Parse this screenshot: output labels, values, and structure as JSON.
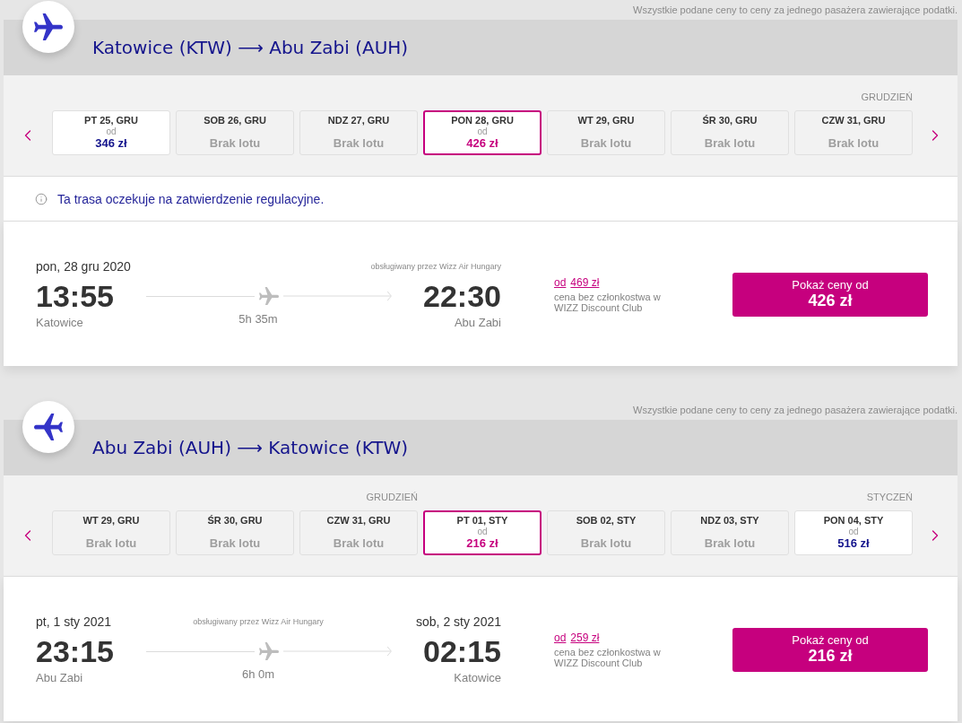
{
  "sections": [
    {
      "kind": "outbound",
      "price_note": "Wszystkie podane ceny to ceny za jednego pasażera zawierające podatki.",
      "title": "Katowice (KTW) ⟶ Abu Zabi (AUH)",
      "date_strip": {
        "days": [
          {
            "label": "PT 25, GRU",
            "available": true,
            "selected": false,
            "from_label": "od",
            "price": "346 zł"
          },
          {
            "label": "SOB 26, GRU",
            "available": false,
            "selected": false,
            "status": "Brak lotu"
          },
          {
            "label": "NDZ 27, GRU",
            "available": false,
            "selected": false,
            "status": "Brak lotu"
          },
          {
            "label": "PON 28, GRU",
            "available": true,
            "selected": true,
            "from_label": "od",
            "price": "426 zł"
          },
          {
            "label": "WT 29, GRU",
            "available": false,
            "selected": false,
            "status": "Brak lotu"
          },
          {
            "label": "ŚR 30, GRU",
            "available": false,
            "selected": false,
            "status": "Brak lotu"
          },
          {
            "label": "CZW 31, GRU",
            "available": false,
            "selected": false,
            "status": "Brak lotu",
            "month": "GRUDZIEŃ"
          }
        ]
      },
      "notice": "Ta trasa oczekuje na zatwierdzenie regulacyjne.",
      "flight": {
        "departure": {
          "date": "pon, 28 gru 2020",
          "time": "13:55",
          "city": "Katowice"
        },
        "route": {
          "duration": "5h 35m"
        },
        "arrival": {
          "operator": "obsługiwany przez Wizz Air Hungary",
          "time": "22:30",
          "city": "Abu Zabi"
        },
        "club_price": {
          "from_label": "od",
          "price": "469 zł",
          "note": "cena bez członkostwa w WIZZ Discount Club"
        },
        "button": {
          "label": "Pokaż ceny od",
          "price": "426 zł"
        }
      }
    },
    {
      "kind": "return",
      "price_note": "Wszystkie podane ceny to ceny za jednego pasażera zawierające podatki.",
      "title": "Abu Zabi (AUH) ⟶ Katowice (KTW)",
      "date_strip": {
        "days": [
          {
            "label": "WT 29, GRU",
            "available": false,
            "selected": false,
            "status": "Brak lotu"
          },
          {
            "label": "ŚR 30, GRU",
            "available": false,
            "selected": false,
            "status": "Brak lotu"
          },
          {
            "label": "CZW 31, GRU",
            "available": false,
            "selected": false,
            "status": "Brak lotu",
            "month": "GRUDZIEŃ"
          },
          {
            "label": "PT 01, STY",
            "available": true,
            "selected": true,
            "from_label": "od",
            "price": "216 zł"
          },
          {
            "label": "SOB 02, STY",
            "available": false,
            "selected": false,
            "status": "Brak lotu"
          },
          {
            "label": "NDZ 03, STY",
            "available": false,
            "selected": false,
            "status": "Brak lotu"
          },
          {
            "label": "PON 04, STY",
            "available": true,
            "selected": false,
            "from_label": "od",
            "price": "516 zł",
            "month": "STYCZEŃ"
          }
        ]
      },
      "flight": {
        "departure": {
          "date": "pt, 1 sty 2021",
          "time": "23:15",
          "city": "Abu Zabi"
        },
        "route": {
          "operator": "obsługiwany przez Wizz Air Hungary",
          "duration": "6h 0m"
        },
        "arrival": {
          "date": "sob, 2 sty 2021",
          "time": "02:15",
          "city": "Katowice"
        },
        "club_price": {
          "from_label": "od",
          "price": "259 zł",
          "note": "cena bez członkostwa w WIZZ Discount Club"
        },
        "button": {
          "label": "Pokaż ceny od",
          "price": "216 zł"
        }
      }
    }
  ]
}
